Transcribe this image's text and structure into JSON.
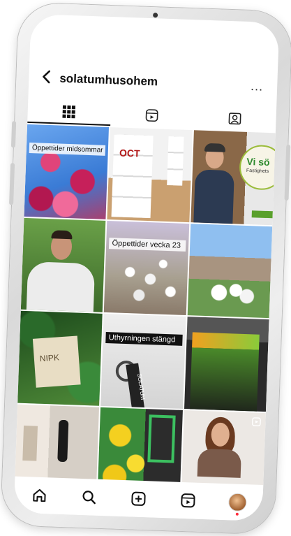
{
  "header": {
    "back_icon": "chevron-left-icon",
    "username": "solatumhusohem",
    "more_label": "..."
  },
  "tabs": [
    {
      "name": "tab-posts-grid",
      "icon": "grid-icon",
      "active": true
    },
    {
      "name": "tab-reels",
      "icon": "reels-icon",
      "active": false
    },
    {
      "name": "tab-tagged",
      "icon": "tagged-icon",
      "active": false
    }
  ],
  "grid": {
    "captions": {
      "c1": "Öppettider midsommar",
      "c5": "Öppettider vecka 23",
      "c8": "Uthyrningen stängd"
    },
    "posts": [
      {
        "label": "pink-blossoms-post"
      },
      {
        "label": "octo-boxes-post",
        "text": "OCT"
      },
      {
        "label": "man-portrait-post",
        "badge_text": "Vi sö",
        "badge_sub": "Fastighets"
      },
      {
        "label": "man-green-post"
      },
      {
        "label": "white-blossoms-post"
      },
      {
        "label": "building-blossoms-post"
      },
      {
        "label": "sign-plants-post",
        "text": "NIPK"
      },
      {
        "label": "keys-post",
        "text": "SOLATUM"
      },
      {
        "label": "event-tent-post"
      },
      {
        "label": "interior-post"
      },
      {
        "label": "daffodils-post"
      },
      {
        "label": "woman-portrait-post"
      }
    ]
  },
  "bottom_nav": [
    {
      "name": "nav-home",
      "icon": "home-icon"
    },
    {
      "name": "nav-search",
      "icon": "search-icon"
    },
    {
      "name": "nav-create",
      "icon": "add-post-icon"
    },
    {
      "name": "nav-reels",
      "icon": "reels-icon"
    },
    {
      "name": "nav-profile",
      "icon": "profile-avatar-icon"
    }
  ]
}
